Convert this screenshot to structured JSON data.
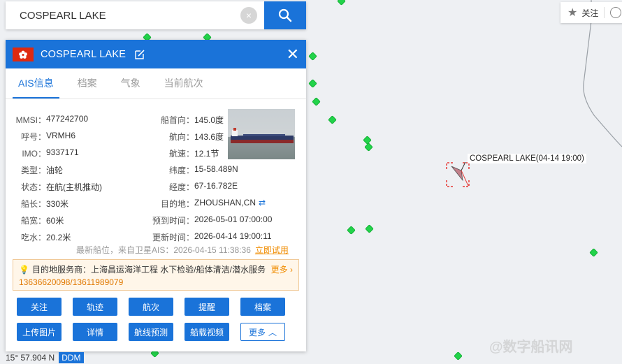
{
  "search": {
    "value": "COSPEARL LAKE"
  },
  "top_right": {
    "follow_label": "关注"
  },
  "panel": {
    "ship_name": "COSPEARL LAKE",
    "tabs": [
      "AIS信息",
      "档案",
      "气象",
      "当前航次"
    ],
    "left_fields": [
      {
        "label": "MMSI：",
        "value": "477242700"
      },
      {
        "label": "呼号：",
        "value": "VRMH6"
      },
      {
        "label": "IMO：",
        "value": "9337171"
      },
      {
        "label": "类型：",
        "value": "油轮"
      },
      {
        "label": "状态：",
        "value": "在航(主机推动)"
      },
      {
        "label": "船长：",
        "value": "330米"
      },
      {
        "label": "船宽：",
        "value": "60米"
      },
      {
        "label": "吃水：",
        "value": "20.2米"
      }
    ],
    "right_fields": [
      {
        "label": "船首向：",
        "value": "145.0度"
      },
      {
        "label": "航向：",
        "value": "143.6度"
      },
      {
        "label": "航速：",
        "value": "12.1节"
      },
      {
        "label": "纬度：",
        "value": "15-58.489N"
      },
      {
        "label": "经度：",
        "value": "67-16.782E"
      },
      {
        "label": "目的地：",
        "value": "ZHOUSHAN,CN"
      },
      {
        "label": "预到时间：",
        "value": "2026-05-01 07:00:00"
      },
      {
        "label": "更新时间：",
        "value": "2026-04-14 19:00:11"
      }
    ],
    "sat_note": "最新船位，来自卫星AIS：2026-04-15 11:38:36",
    "sat_link": "立即试用",
    "service": {
      "prefix": "目的地服务商：",
      "text": "上海昌运海洋工程 水下检验/船体清洁/潜水服务",
      "phone": "13636620098/13611989079",
      "more": "更多"
    },
    "buttons_row1": [
      "关注",
      "轨迹",
      "航次",
      "提醒",
      "档案"
    ],
    "buttons_row2": [
      "上传图片",
      "详情",
      "航线预测",
      "船载视频",
      "更多"
    ]
  },
  "map": {
    "ship_label": "COSPEARL LAKE(04-14 19:00)",
    "coord": "15° 57.904 N",
    "coord_mode": "DDM",
    "watermark": "@数字船讯网"
  },
  "colors": {
    "accent": "#1a73d9",
    "flag": "#de2910",
    "dots": "#22d34a",
    "warning": "#f08c00"
  }
}
